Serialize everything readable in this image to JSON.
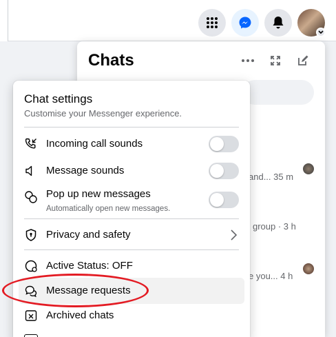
{
  "header": {
    "icons": [
      "menu-grid-icon",
      "messenger-icon",
      "bell-icon",
      "profile-avatar",
      "chevron-down-icon"
    ]
  },
  "chats_panel": {
    "title": "Chats",
    "previews": [
      {
        "text": "and... 35 m"
      },
      {
        "text": "group · 3 h"
      },
      {
        "text": "e you...  4 h"
      }
    ]
  },
  "settings": {
    "title": "Chat settings",
    "subtitle": "Customise your Messenger experience.",
    "incoming_call_sounds": {
      "label": "Incoming call sounds",
      "enabled": false
    },
    "message_sounds": {
      "label": "Message sounds",
      "enabled": false
    },
    "popup_messages": {
      "label": "Pop up new messages",
      "sub": "Automatically open new messages.",
      "enabled": false
    },
    "privacy": {
      "label": "Privacy and safety"
    },
    "active_status": {
      "label": "Active Status: OFF"
    },
    "message_requests": {
      "label": "Message requests"
    },
    "archived_chats": {
      "label": "Archived chats"
    }
  },
  "colors": {
    "accent": "#0866ff",
    "highlight": "#e31b23",
    "toggle_off": "#dadde1"
  }
}
